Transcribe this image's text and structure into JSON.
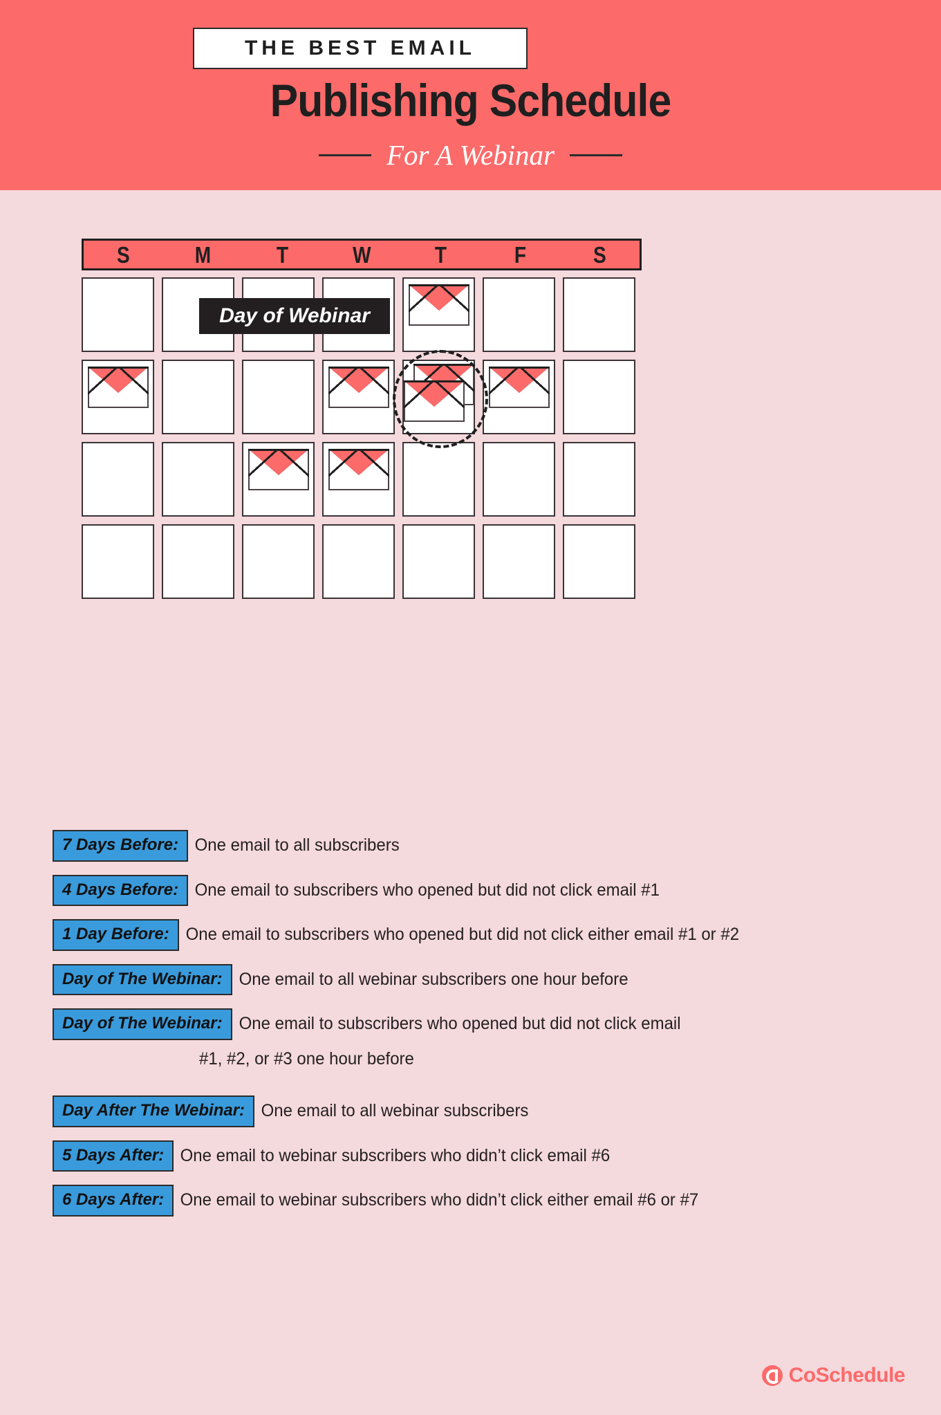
{
  "header": {
    "kicker": "THE BEST EMAIL",
    "title": "Publishing Schedule",
    "subtitle": "For A Webinar",
    "bg_color": "#fc6a6a",
    "page_bg_color": "#f4d9dd"
  },
  "calendar": {
    "day_headers": [
      "S",
      "M",
      "T",
      "W",
      "T",
      "F",
      "S"
    ],
    "webinar_label": "Day of Webinar",
    "rows": [
      [
        {
          "envelopes": 0
        },
        {
          "envelopes": 0
        },
        {
          "envelopes": 0
        },
        {
          "envelopes": 0
        },
        {
          "envelopes": 1
        },
        {
          "envelopes": 0
        },
        {
          "envelopes": 0
        }
      ],
      [
        {
          "envelopes": 1
        },
        {
          "envelopes": 0
        },
        {
          "envelopes": 0
        },
        {
          "envelopes": 1
        },
        {
          "envelopes": 2,
          "highlighted": true
        },
        {
          "envelopes": 1
        },
        {
          "envelopes": 0
        }
      ],
      [
        {
          "envelopes": 0
        },
        {
          "envelopes": 0
        },
        {
          "envelopes": 1
        },
        {
          "envelopes": 1
        },
        {
          "envelopes": 0
        },
        {
          "envelopes": 0
        },
        {
          "envelopes": 0
        }
      ],
      [
        {
          "envelopes": 0
        },
        {
          "envelopes": 0
        },
        {
          "envelopes": 0
        },
        {
          "envelopes": 0
        },
        {
          "envelopes": 0
        },
        {
          "envelopes": 0
        },
        {
          "envelopes": 0
        }
      ]
    ],
    "envelope_color": "#fc6a6a",
    "header_bg": "#fc6a6a"
  },
  "legend": {
    "badge_color": "#3a9bdc",
    "items": [
      {
        "badge": "7 Days Before:",
        "desc": "One email to all subscribers",
        "cont": ""
      },
      {
        "badge": "4 Days Before:",
        "desc": "One email to subscribers who opened but did not click email #1",
        "cont": ""
      },
      {
        "badge": "1 Day Before:",
        "desc": "One email to subscribers who opened but did not click either email #1 or #2",
        "cont": ""
      },
      {
        "badge": "Day of The Webinar:",
        "desc": "One email to all webinar subscribers one hour before",
        "cont": ""
      },
      {
        "badge": "Day of The Webinar:",
        "desc": "One email to subscribers who opened but did not click email",
        "cont": "#1, #2, or #3 one hour before"
      },
      {
        "badge": "Day After The Webinar:",
        "desc": "One email to all webinar subscribers",
        "cont": ""
      },
      {
        "badge": "5 Days After:",
        "desc": "One email to webinar subscribers who didn’t click email #6",
        "cont": ""
      },
      {
        "badge": "6 Days After:",
        "desc": "One email to webinar subscribers who didn’t click either email #6 or #7",
        "cont": ""
      }
    ]
  },
  "footer": {
    "brand": "CoSchedule",
    "brand_color": "#fc6a6a"
  }
}
